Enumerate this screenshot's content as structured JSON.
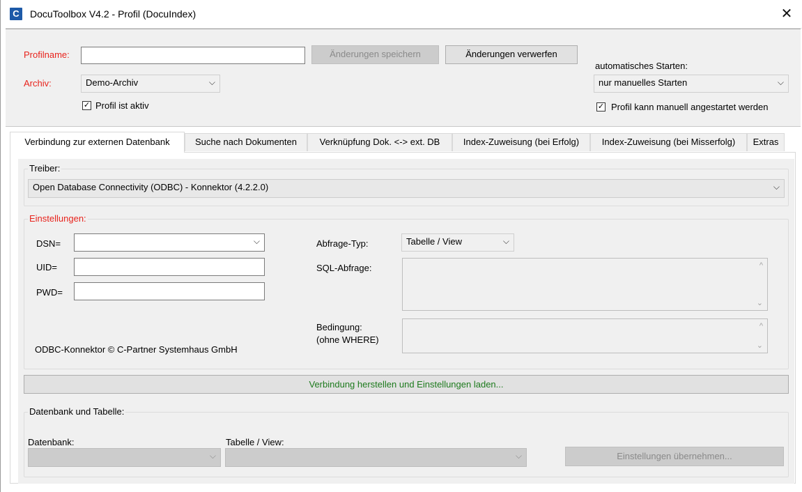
{
  "window": {
    "title": "DocuToolbox V4.2 - Profil (DocuIndex)",
    "app_icon_letter": "C",
    "close_glyph": "✕"
  },
  "header": {
    "profilname_label": "Profilname:",
    "profilname_value": "",
    "save_button": "Änderungen speichern",
    "discard_button": "Änderungen verwerfen",
    "archiv_label": "Archiv:",
    "archiv_value": "Demo-Archiv",
    "profil_aktiv_label": "Profil ist aktiv",
    "profil_aktiv_checked": true,
    "auto_start_label": "automatisches Starten:",
    "auto_start_value": "nur manuelles Starten",
    "manual_start_label": "Profil kann manuell angestartet werden",
    "manual_start_checked": true
  },
  "tabs": [
    {
      "label": "Verbindung zur externen Datenbank",
      "active": true
    },
    {
      "label": "Suche nach Dokumenten",
      "active": false
    },
    {
      "label": "Verknüpfung Dok. <-> ext. DB",
      "active": false
    },
    {
      "label": "Index-Zuweisung (bei Erfolg)",
      "active": false
    },
    {
      "label": "Index-Zuweisung (bei Misserfolg)",
      "active": false
    },
    {
      "label": "Extras",
      "active": false
    }
  ],
  "treiber": {
    "group_label": "Treiber:",
    "value": "Open Database Connectivity (ODBC) - Konnektor (4.2.2.0)"
  },
  "einstellungen": {
    "group_label": "Einstellungen:",
    "dsn_label": "DSN=",
    "dsn_value": "",
    "uid_label": "UID=",
    "uid_value": "",
    "pwd_label": "PWD=",
    "pwd_value": "",
    "abfrage_typ_label": "Abfrage-Typ:",
    "abfrage_typ_value": "Tabelle / View",
    "sql_label": "SQL-Abfrage:",
    "bedingung_label_1": "Bedingung:",
    "bedingung_label_2": "(ohne WHERE)",
    "copyright": "ODBC-Konnektor © C-Partner Systemhaus GmbH"
  },
  "connect_button": "Verbindung herstellen und Einstellungen laden...",
  "db_table": {
    "group_label": "Datenbank und Tabelle:",
    "datenbank_label": "Datenbank:",
    "tabelle_label": "Tabelle / View:",
    "apply_button": "Einstellungen übernehmen..."
  },
  "icons": {
    "chevron": "⌵",
    "check": "✓",
    "scroll_up": "^",
    "scroll_down": "⌄"
  },
  "colors": {
    "required_label": "#e8231c",
    "connect_text": "#1d7a1d",
    "app_icon": "#1e5aa8"
  }
}
